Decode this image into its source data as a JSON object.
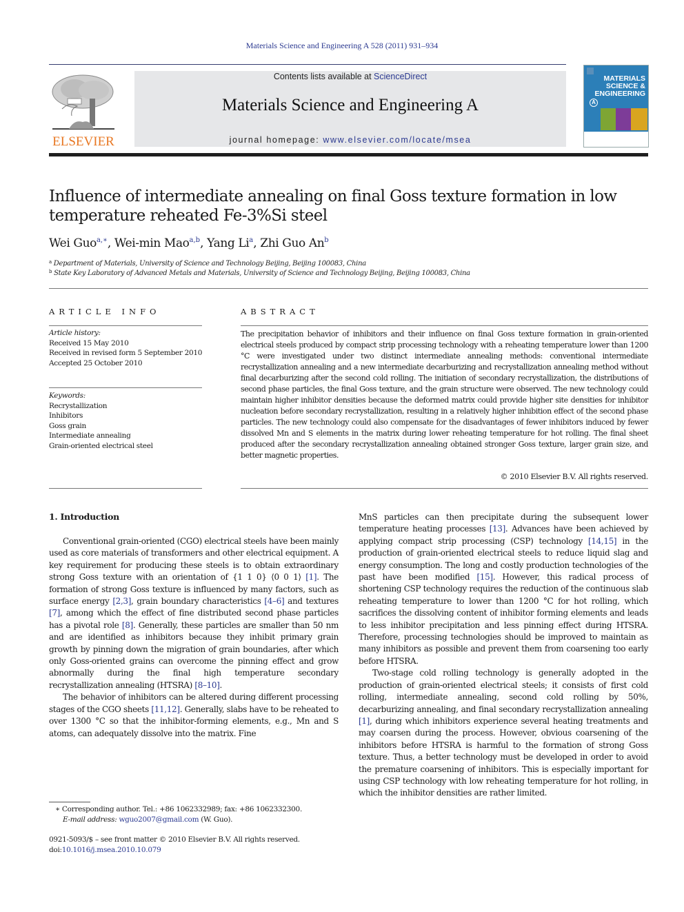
{
  "header": {
    "journal_citation": "Materials Science and Engineering A 528 (2011) 931–934",
    "contents_prefix": "Contents lists available at ",
    "contents_link": "ScienceDirect",
    "journal_title": "Materials Science and Engineering A",
    "homepage_prefix": "journal homepage: ",
    "homepage_link": "www.elsevier.com/locate/msea",
    "publisher_logo_text": "ELSEVIER",
    "cover": {
      "title_line1": "MATERIALS",
      "title_line2": "SCIENCE &",
      "title_line3": "ENGINEERING",
      "series_letter": "A"
    },
    "colors": {
      "link": "#2b3990",
      "elsevier_orange": "#e87722",
      "masthead_bg": "#e6e7e9"
    }
  },
  "article": {
    "title": "Influence of intermediate annealing on final Goss texture formation in low temperature reheated Fe-3%Si steel",
    "authors": [
      {
        "name": "Wei Guo",
        "sup": "a,∗",
        "sep": ", "
      },
      {
        "name": "Wei-min Mao",
        "sup": "a,b",
        "sep": ", "
      },
      {
        "name": "Yang Li",
        "sup": "a",
        "sep": ", "
      },
      {
        "name": "Zhi Guo An",
        "sup": "b",
        "sep": ""
      }
    ],
    "affiliations": [
      {
        "mark": "a",
        "text": "Department of Materials, University of Science and Technology Beijing, Beijing 100083, China"
      },
      {
        "mark": "b",
        "text": "State Key Laboratory of Advanced Metals and Materials, University of Science and Technology Beijing, Beijing 100083, China"
      }
    ]
  },
  "article_info": {
    "heading": "ARTICLE INFO",
    "history_label": "Article history:",
    "history": [
      "Received 15 May 2010",
      "Received in revised form 5 September 2010",
      "Accepted 25 October 2010"
    ],
    "keywords_label": "Keywords:",
    "keywords": [
      "Recrystallization",
      "Inhibitors",
      "Goss grain",
      "Intermediate annealing",
      "Grain-oriented electrical steel"
    ]
  },
  "abstract": {
    "heading": "ABSTRACT",
    "text": "The precipitation behavior of inhibitors and their influence on final Goss texture formation in grain-oriented electrical steels produced by compact strip processing technology with a reheating temperature lower than 1200 °C were investigated under two distinct intermediate annealing methods: conventional intermediate recrystallization annealing and a new intermediate decarburizing and recrystallization annealing method without final decarburizing after the second cold rolling. The initiation of secondary recrystallization, the distributions of second phase particles, the final Goss texture, and the grain structure were observed. The new technology could maintain higher inhibitor densities because the deformed matrix could provide higher site densities for inhibitor nucleation before secondary recrystallization, resulting in a relatively higher inhibition effect of the second phase particles. The new technology could also compensate for the disadvantages of fewer inhibitors induced by fewer dissolved Mn and S elements in the matrix during lower reheating temperature for hot rolling. The final sheet produced after the secondary recrystallization annealing obtained stronger Goss texture, larger grain size, and better magnetic properties.",
    "copyright": "© 2010 Elsevier B.V. All rights reserved."
  },
  "body": {
    "section_heading": "1.  Introduction",
    "left_paragraphs": [
      [
        {
          "t": "Conventional grain-oriented (CGO) electrical steels have been mainly used as core materials of transformers and other electrical equipment. A key requirement for producing these steels is to obtain extraordinary strong Goss texture with an orientation of {1 1 0} ⟨0 0 1⟩ "
        },
        {
          "c": "[1]"
        },
        {
          "t": ". The formation of strong Goss texture is influenced by many factors, such as surface energy "
        },
        {
          "c": "[2,3]"
        },
        {
          "t": ", grain boundary characteristics "
        },
        {
          "c": "[4–6]"
        },
        {
          "t": " and textures "
        },
        {
          "c": "[7]"
        },
        {
          "t": ", among which the effect of fine distributed second phase particles has a pivotal role "
        },
        {
          "c": "[8]"
        },
        {
          "t": ". Generally, these particles are smaller than 50 nm and are identified as inhibitors because they inhibit primary grain growth by pinning down the migration of grain boundaries, after which only Goss-oriented grains can overcome the pinning effect and grow abnormally during the final high temperature secondary recrystallization annealing (HTSRA) "
        },
        {
          "c": "[8–10]"
        },
        {
          "t": "."
        }
      ],
      [
        {
          "t": "The behavior of inhibitors can be altered during different processing stages of the CGO sheets "
        },
        {
          "c": "[11,12]"
        },
        {
          "t": ". Generally, slabs have to be reheated to over 1300 °C so that the inhibitor-forming elements, e.g., Mn and S atoms, can adequately dissolve into the matrix. Fine"
        }
      ]
    ],
    "right_paragraphs": [
      [
        {
          "t": "MnS particles can then precipitate during the subsequent lower temperature heating processes "
        },
        {
          "c": "[13]"
        },
        {
          "t": ". Advances have been achieved by applying compact strip processing (CSP) technology "
        },
        {
          "c": "[14,15]"
        },
        {
          "t": " in the production of grain-oriented electrical steels to reduce liquid slag and energy consumption. The long and costly production technologies of the past have been modified "
        },
        {
          "c": "[15]"
        },
        {
          "t": ". However, this radical process of shortening CSP technology requires the reduction of the continuous slab reheating temperature to lower than 1200 °C for hot rolling, which sacrifices the dissolving content of inhibitor forming elements and leads to less inhibitor precipitation and less pinning effect during HTSRA. Therefore, processing technologies should be improved to maintain as many inhibitors as possible and prevent them from coarsening too early before HTSRA."
        }
      ],
      [
        {
          "t": "Two-stage cold rolling technology is generally adopted in the production of grain-oriented electrical steels; it consists of first cold rolling, intermediate annealing, second cold rolling by 50%, decarburizing annealing, and final secondary recrystallization annealing "
        },
        {
          "c": "[1]"
        },
        {
          "t": ", during which inhibitors experience several heating treatments and may coarsen during the process. However, obvious coarsening of the inhibitors before HTSRA is harmful to the formation of strong Goss texture. Thus, a better technology must be developed in order to avoid the premature coarsening of inhibitors. This is especially important for using CSP technology with low reheating temperature for hot rolling, in which the inhibitor densities are rather limited."
        }
      ]
    ]
  },
  "footnotes": {
    "corresponding": "∗  Corresponding author. Tel.: +86 1062332989; fax: +86 1062332300.",
    "email_label": "E-mail address: ",
    "email": "wguo2007@gmail.com",
    "email_suffix": " (W. Guo).",
    "front_matter": "0921-5093/$ – see front matter © 2010 Elsevier B.V. All rights reserved.",
    "doi_prefix": "doi:",
    "doi": "10.1016/j.msea.2010.10.079"
  }
}
